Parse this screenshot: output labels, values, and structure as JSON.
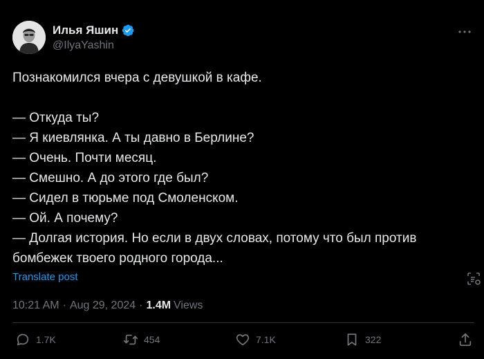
{
  "author": {
    "name": "Илья Яшин",
    "handle": "@IlyaYashin"
  },
  "post": {
    "text": "Познакомился вчера с девушкой в кафе.\n\n— Откуда ты?\n— Я киевлянка. А ты давно в Берлине?\n— Очень. Почти месяц.\n— Смешно. А до этого где был?\n— Сидел в тюрьме под Смоленском.\n— Ой. А почему?\n— Долгая история. Но если в двух словах, потому что был против бомбежек твоего родного города...",
    "translate_label": "Translate post",
    "time": "10:21 AM",
    "date": "Aug 29, 2024",
    "views_count": "1.4M",
    "views_label": "Views",
    "separator": "·"
  },
  "actions": {
    "replies": "1.7K",
    "reposts": "454",
    "likes": "7.1K",
    "bookmarks": "322"
  },
  "icons": {
    "verified": "verified-badge-icon",
    "more": "more-dots-icon",
    "grok": "grok-icon",
    "reply": "reply-icon",
    "repost": "repost-icon",
    "like": "heart-icon",
    "bookmark": "bookmark-icon",
    "share": "share-icon"
  },
  "colors": {
    "background": "#000000",
    "text": "#e7e9ea",
    "secondary": "#71767b",
    "accent": "#1d9bf0"
  }
}
